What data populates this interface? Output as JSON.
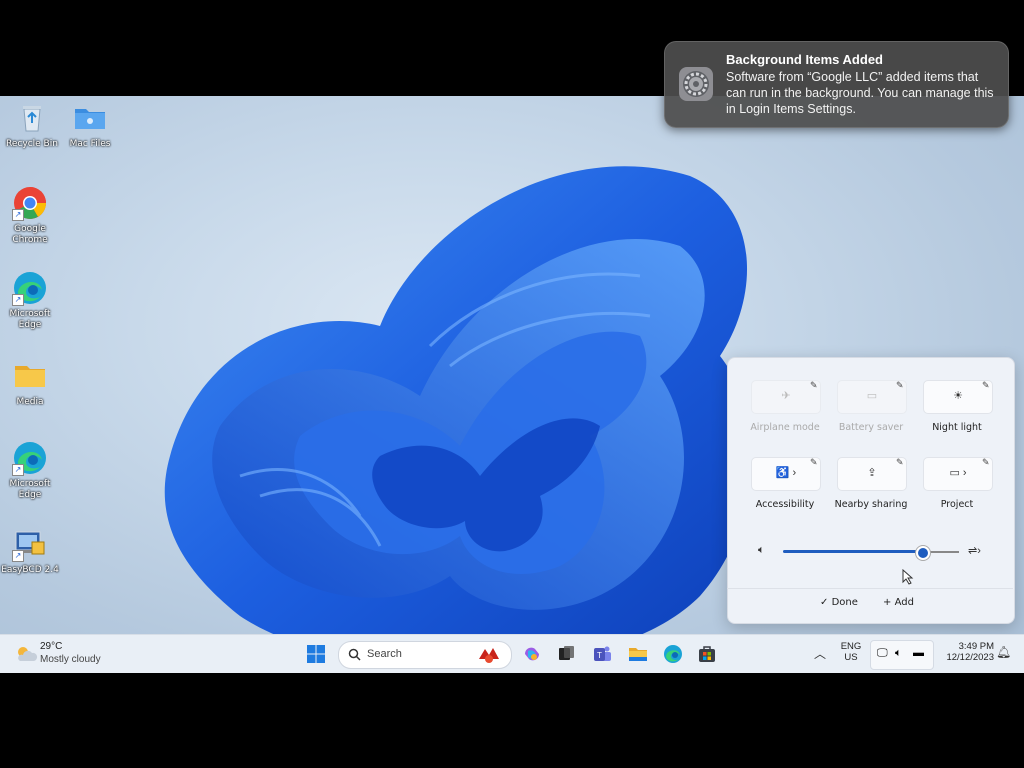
{
  "notification": {
    "title": "Background Items Added",
    "body": "Software from “Google LLC” added items that can run in the background. You can manage this in Login Items Settings.",
    "icon": "gear-icon"
  },
  "desktop_icons": [
    {
      "label": "Recycle Bin",
      "icon": "recycle-bin-icon"
    },
    {
      "label": "Mac Files",
      "icon": "folder-icon"
    },
    {
      "label": "Google Chrome",
      "icon": "chrome-icon"
    },
    {
      "label": "Microsoft Edge",
      "icon": "edge-icon"
    },
    {
      "label": "Media",
      "icon": "folder-icon"
    },
    {
      "label": "Microsoft Edge",
      "icon": "edge-icon"
    },
    {
      "label": "EasyBCD 2.4",
      "icon": "easybcd-icon"
    }
  ],
  "quick_settings": {
    "tiles": [
      {
        "label": "Airplane mode",
        "icon": "airplane-icon",
        "disabled": true
      },
      {
        "label": "Battery saver",
        "icon": "battery-icon",
        "disabled": true
      },
      {
        "label": "Night light",
        "icon": "night-light-icon",
        "disabled": false
      },
      {
        "label": "Accessibility",
        "icon": "accessibility-icon",
        "disabled": false
      },
      {
        "label": "Nearby sharing",
        "icon": "share-icon",
        "disabled": false
      },
      {
        "label": "Project",
        "icon": "project-icon",
        "disabled": false
      }
    ],
    "volume_level": 0.79,
    "done_label": "Done",
    "add_label": "Add"
  },
  "taskbar": {
    "weather_temp": "29°C",
    "weather_desc": "Mostly cloudy",
    "search_placeholder": "Search",
    "language_line1": "ENG",
    "language_line2": "US",
    "time": "3:49 PM",
    "date": "12/12/2023"
  },
  "colors": {
    "accent": "#1f5dbf",
    "wallpaper_blue": "#1d5fe0"
  }
}
